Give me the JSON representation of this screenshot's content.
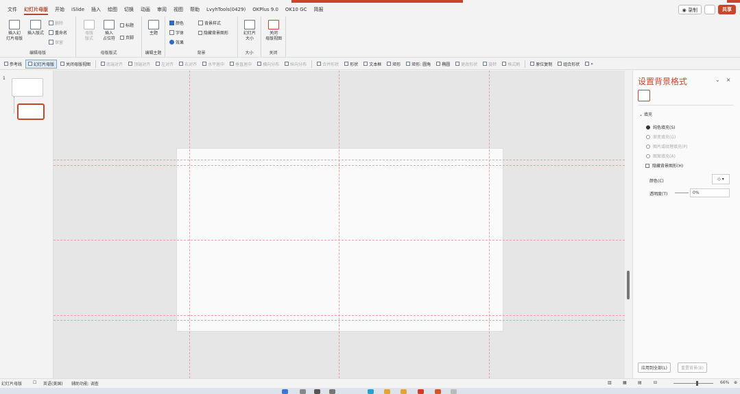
{
  "menu": {
    "tabs": [
      "文件",
      "幻灯片母版",
      "开始",
      "iSlide",
      "插入",
      "绘图",
      "切换",
      "动画",
      "审阅",
      "视图",
      "帮助",
      "LvyhTools(0429)",
      "OKPlus 9.0",
      "OK10 GC",
      "简报"
    ],
    "record_label": "◉ 录制",
    "share_label": "共享"
  },
  "ribbon": {
    "insert_master": "插入幻\n灯片母版",
    "insert_layout": "插入版式",
    "delete": "删除",
    "rename": "重命名",
    "preserve": "保留",
    "group_edit_master": "编辑母版",
    "master_layout": "母版\n版式",
    "insert_placeholder": "插入\n占位符",
    "title_check": "标题",
    "footer_check": "页脚",
    "group_master_layout": "母版版式",
    "theme": "主题",
    "group_edit_theme": "编辑主题",
    "colors": "颜色",
    "fonts": "字体",
    "effects": "效果",
    "bg_styles": "背景样式",
    "hide_bg": "隐藏背景图形",
    "group_background": "背景",
    "slide_size": "幻灯片\n大小",
    "group_size": "大小",
    "close_master": "关闭\n母版视图",
    "group_close": "关闭"
  },
  "toolbar": {
    "items": [
      {
        "label": "参考线",
        "state": "normal"
      },
      {
        "label": "幻灯片母版",
        "state": "active"
      },
      {
        "label": "关闭母版视图",
        "state": "normal"
      },
      {
        "label": "|",
        "state": "sep"
      },
      {
        "label": "底端对齐",
        "state": "dis"
      },
      {
        "label": "顶端对齐",
        "state": "dis"
      },
      {
        "label": "左对齐",
        "state": "dis"
      },
      {
        "label": "右对齐",
        "state": "dis"
      },
      {
        "label": "水平居中",
        "state": "dis"
      },
      {
        "label": "垂直居中",
        "state": "dis"
      },
      {
        "label": "横向分布",
        "state": "dis"
      },
      {
        "label": "纵向分布",
        "state": "dis"
      },
      {
        "label": "|",
        "state": "sep"
      },
      {
        "label": "合并形状",
        "state": "dis"
      },
      {
        "label": "形状",
        "state": "normal"
      },
      {
        "label": "文本框",
        "state": "normal"
      },
      {
        "label": "矩形",
        "state": "normal"
      },
      {
        "label": "矩形: 圆角",
        "state": "normal"
      },
      {
        "label": "椭圆",
        "state": "normal"
      },
      {
        "label": "更改形状",
        "state": "dis"
      },
      {
        "label": "旋转",
        "state": "dis"
      },
      {
        "label": "格式刷",
        "state": "dis"
      },
      {
        "label": "|",
        "state": "sep"
      },
      {
        "label": "原位复制",
        "state": "normal"
      },
      {
        "label": "组合形状",
        "state": "normal"
      },
      {
        "label": "»",
        "state": "normal"
      }
    ]
  },
  "thumbnails": {
    "slide_number": "1"
  },
  "pane": {
    "title": "设置背景格式",
    "section": "填充",
    "options": [
      {
        "label": "纯色填充(S)",
        "type": "radio",
        "on": true,
        "dis": false
      },
      {
        "label": "渐变填充(G)",
        "type": "radio",
        "on": false,
        "dis": true
      },
      {
        "label": "图片或纹理填充(P)",
        "type": "radio",
        "on": false,
        "dis": true
      },
      {
        "label": "图案填充(A)",
        "type": "radio",
        "on": false,
        "dis": true
      },
      {
        "label": "隐藏背景图形(H)",
        "type": "check",
        "on": false,
        "dis": false
      }
    ],
    "color_label": "颜色(C)",
    "transparency_label": "透明度(T)",
    "transparency_value": "0%",
    "apply_all": "应用到全部(L)",
    "reset_bg": "重置背景(B)"
  },
  "status": {
    "view": "幻灯片母版",
    "lang": "英语(美国)",
    "accessibility": "辅助功能: 调查",
    "zoom": "66%"
  }
}
